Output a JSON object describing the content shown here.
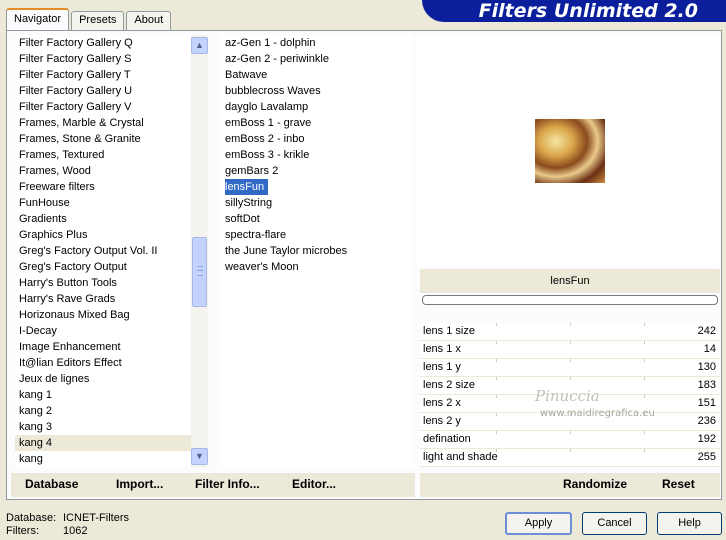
{
  "tabs": [
    "Navigator",
    "Presets",
    "About"
  ],
  "header": {
    "title": "Filters Unlimited 2.0"
  },
  "categories": [
    "Filter Factory Gallery Q",
    "Filter Factory Gallery S",
    "Filter Factory Gallery T",
    "Filter Factory Gallery U",
    "Filter Factory Gallery V",
    "Frames, Marble & Crystal",
    "Frames, Stone & Granite",
    "Frames, Textured",
    "Frames, Wood",
    "Freeware filters",
    "FunHouse",
    "Gradients",
    "Graphics Plus",
    "Greg's Factory Output Vol. II",
    "Greg's Factory Output",
    "Harry's Button Tools",
    "Harry's Rave Grads",
    "Horizonaus Mixed Bag",
    "I-Decay",
    "Image Enhancement",
    "It@lian Editors Effect",
    "Jeux de lignes",
    "kang 1",
    "kang 2",
    "kang 3",
    "kang 4",
    "kang"
  ],
  "filters": [
    "az-Gen 1  -  dolphin",
    "az-Gen 2  -  periwinkle",
    "Batwave",
    "bubblecross Waves",
    "dayglo Lavalamp",
    "emBoss 1  -  grave",
    "emBoss 2  -  inbo",
    "emBoss 3  -  krikle",
    "gemBars 2",
    "lensFun",
    "sillyString",
    "softDot",
    "spectra-flare",
    "the June Taylor microbes",
    "weaver's Moon"
  ],
  "selected_filter": "lensFun",
  "params": [
    {
      "label": "lens 1 size",
      "value": "242"
    },
    {
      "label": "lens 1 x",
      "value": "14"
    },
    {
      "label": "lens 1 y",
      "value": "130"
    },
    {
      "label": "lens 2 size",
      "value": "183"
    },
    {
      "label": "lens 2 x",
      "value": "151"
    },
    {
      "label": "lens 2 y",
      "value": "236"
    },
    {
      "label": "defination",
      "value": "192"
    },
    {
      "label": "light and shade",
      "value": "255"
    }
  ],
  "watermark": {
    "name": "Pinuccia",
    "url": "www.maidiregrafica.eu"
  },
  "left_buttons": {
    "database": "Database",
    "import": "Import...",
    "filter_info": "Filter Info...",
    "editor": "Editor..."
  },
  "right_buttons": {
    "randomize": "Randomize",
    "reset": "Reset"
  },
  "footer": {
    "database_label": "Database:",
    "database_value": "ICNET-Filters",
    "filters_label": "Filters:",
    "filters_value": "1062"
  },
  "dialog_buttons": {
    "apply": "Apply",
    "cancel": "Cancel",
    "help": "Help"
  }
}
